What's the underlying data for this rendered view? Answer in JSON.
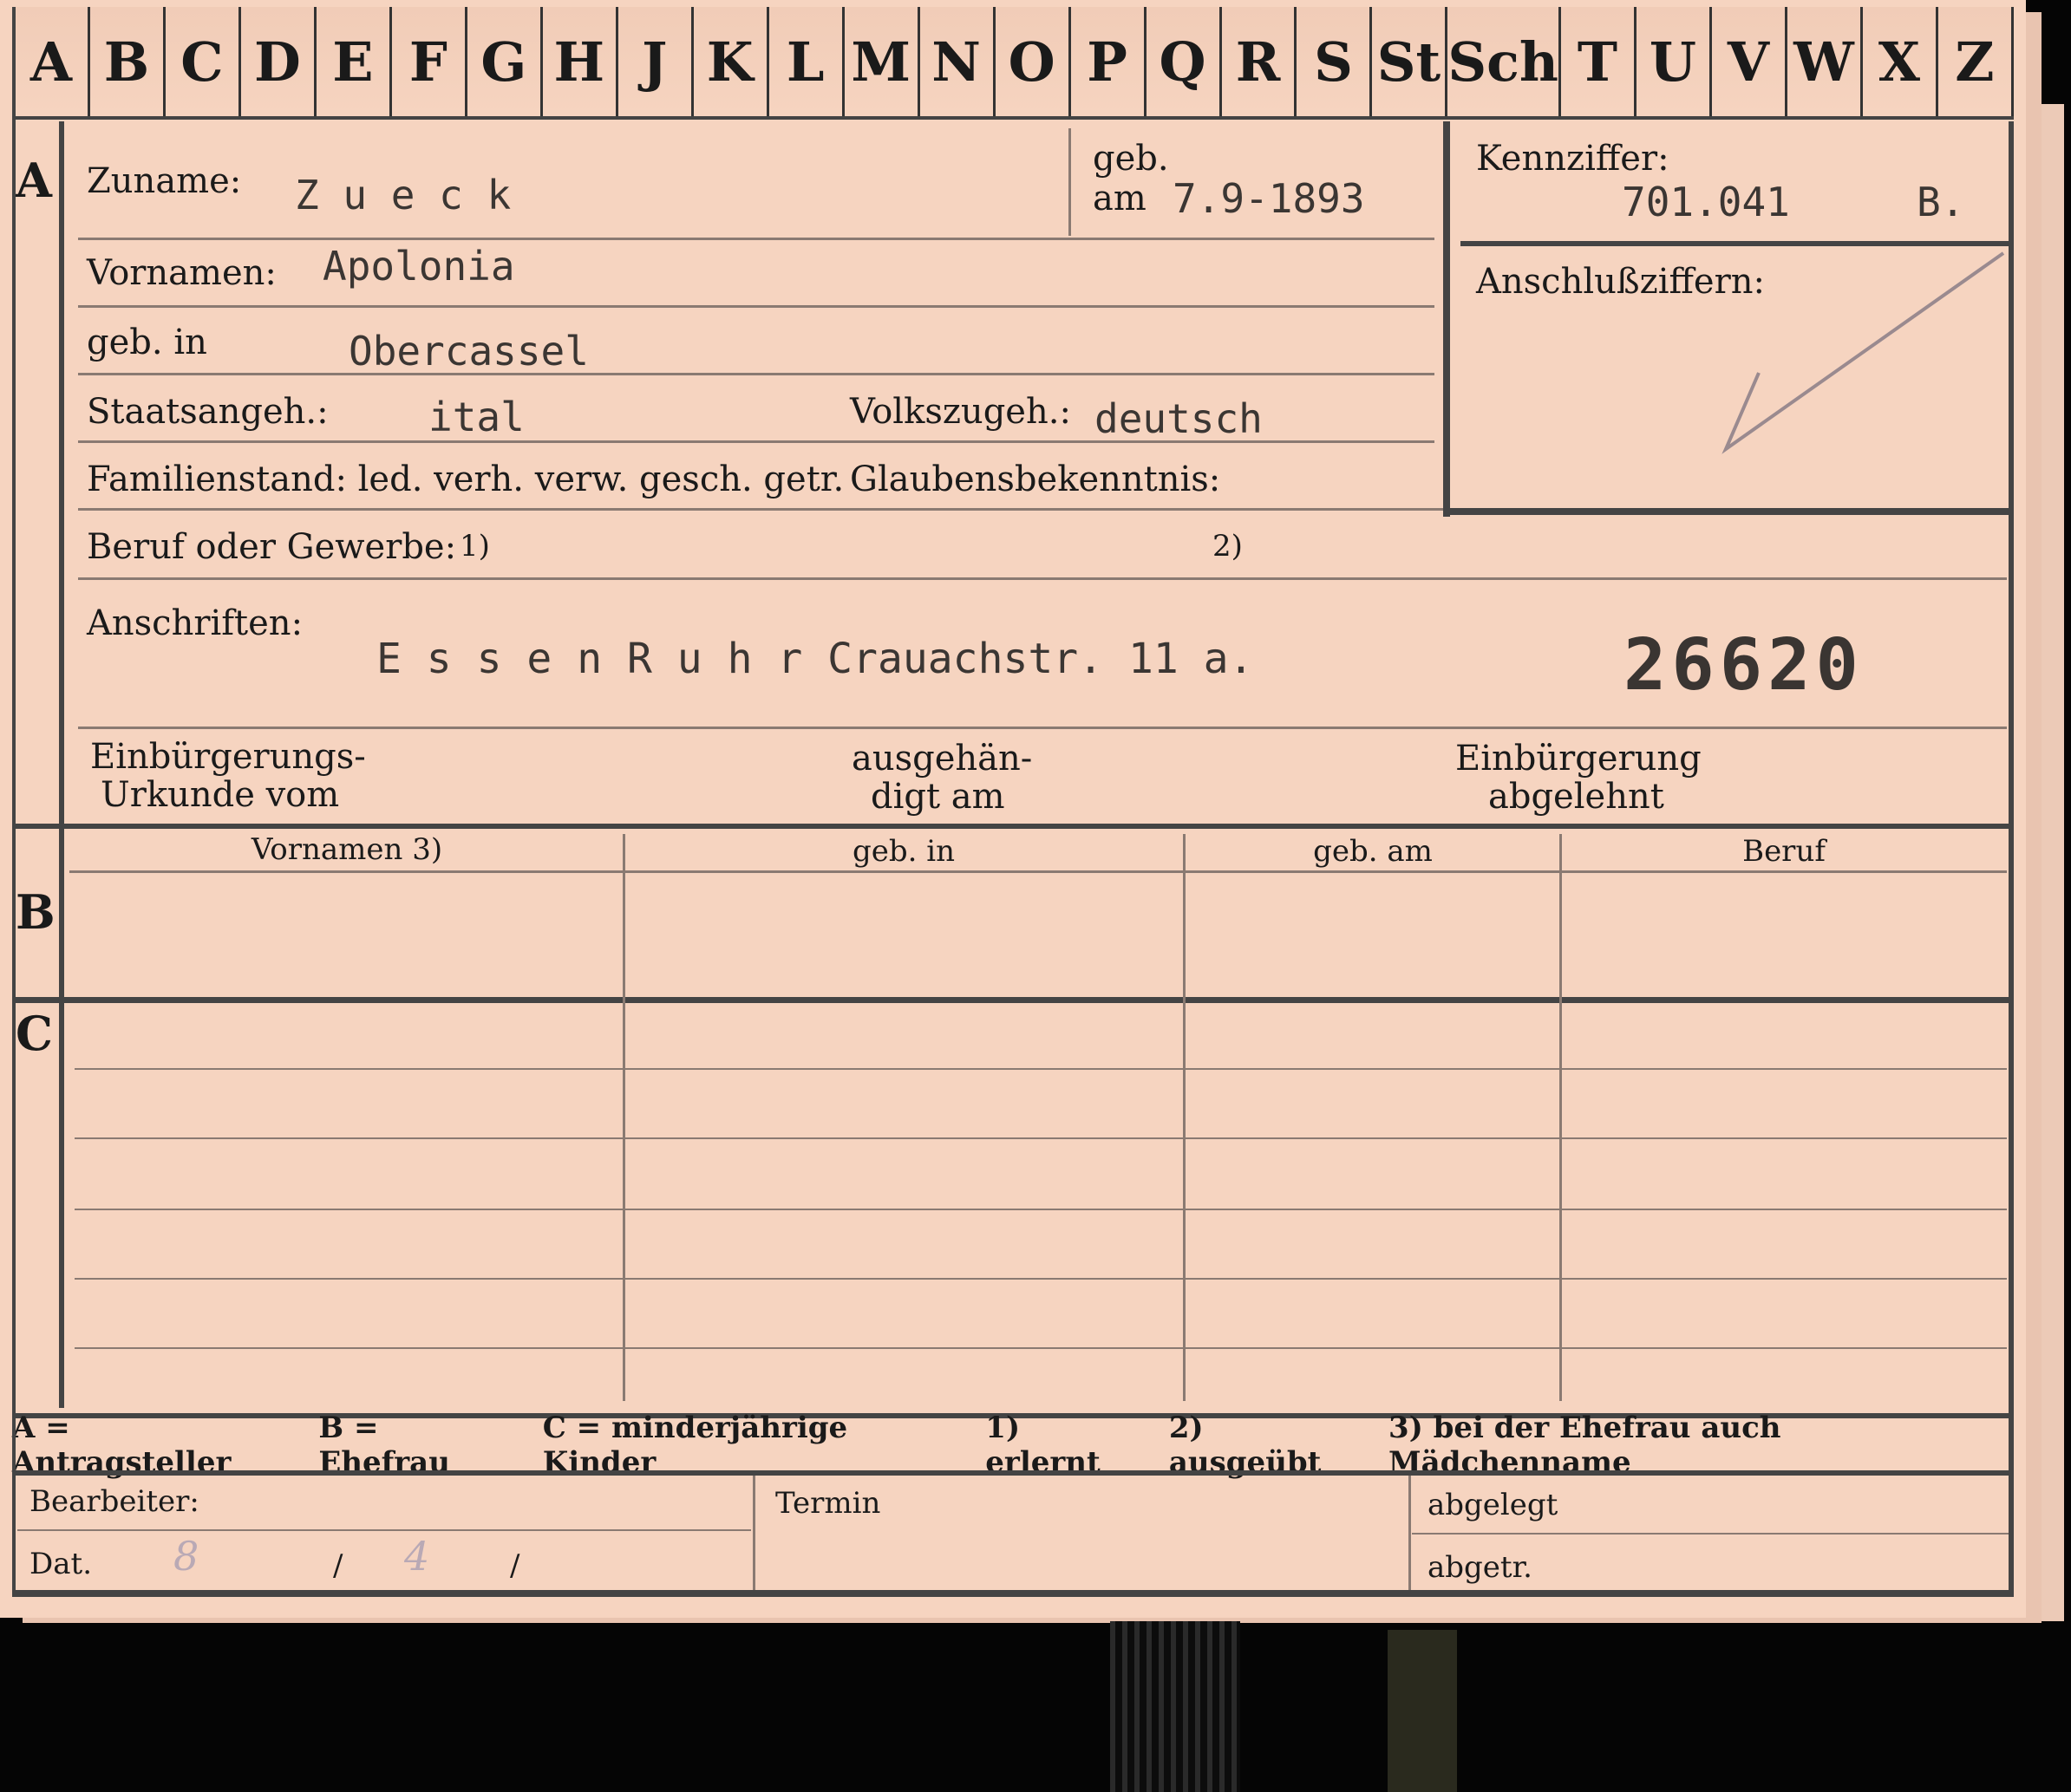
{
  "alphabet_tabs": [
    "A",
    "B",
    "C",
    "D",
    "E",
    "F",
    "G",
    "H",
    "J",
    "K",
    "L",
    "M",
    "N",
    "O",
    "P",
    "Q",
    "R",
    "S",
    "St",
    "Sch",
    "T",
    "U",
    "V",
    "W",
    "X",
    "Z"
  ],
  "sections": {
    "a": "A",
    "b": "B",
    "c": "C"
  },
  "zuname": {
    "label": "Zuname:",
    "value": "Z u e c k"
  },
  "geb_am": {
    "label_line1": "geb.",
    "label_line2": "am",
    "value": "7.9-1893"
  },
  "kennziffer": {
    "label": "Kennziffer:",
    "value": "701.041",
    "suffix": "B."
  },
  "anschlussziffern": {
    "label": "Anschlußziffern:"
  },
  "vornamen": {
    "label": "Vornamen:",
    "value": "Apolonia"
  },
  "geb_in": {
    "label": "geb. in",
    "value": "Obercassel"
  },
  "staatsangeh": {
    "label": "Staatsangeh.:",
    "value": "ital"
  },
  "volkszugeh": {
    "label": "Volkszugeh.:",
    "value": "deutsch"
  },
  "familienstand": {
    "label": "Familienstand: led. verh. verw. gesch. getr."
  },
  "glaubensbekenntnis": {
    "label": "Glaubensbekenntnis:"
  },
  "beruf": {
    "label": "Beruf oder Gewerbe:",
    "mark1": "1)",
    "mark2": "2)"
  },
  "anschriften": {
    "label": "Anschriften:",
    "value": "E s s e n  R u h r  Crauachstr. 11 a.",
    "number": "26620"
  },
  "einbuergerung": {
    "urkunde_line1": "Einbürgerungs-",
    "urkunde_line2": "Urkunde vom",
    "ausgehaendigt_line1": "ausgehän-",
    "ausgehaendigt_line2": "digt am",
    "abgelehnt_line1": "Einbürgerung",
    "abgelehnt_line2": "abgelehnt"
  },
  "table_headers": [
    "Vornamen 3)",
    "geb. in",
    "geb. am",
    "Beruf"
  ],
  "legend": [
    "A = Antragsteller",
    "B = Ehefrau",
    "C = minderjährige Kinder",
    "1) erlernt",
    "2) ausgeübt",
    "3) bei der Ehefrau auch Mädchenname"
  ],
  "footer": {
    "bearbeiter": "Bearbeiter:",
    "dat": "Dat.",
    "dat_day": "8",
    "dat_month": "4",
    "sep": "/",
    "termin": "Termin",
    "abgelegt": "abgelegt",
    "abgetr": "abgetr."
  }
}
